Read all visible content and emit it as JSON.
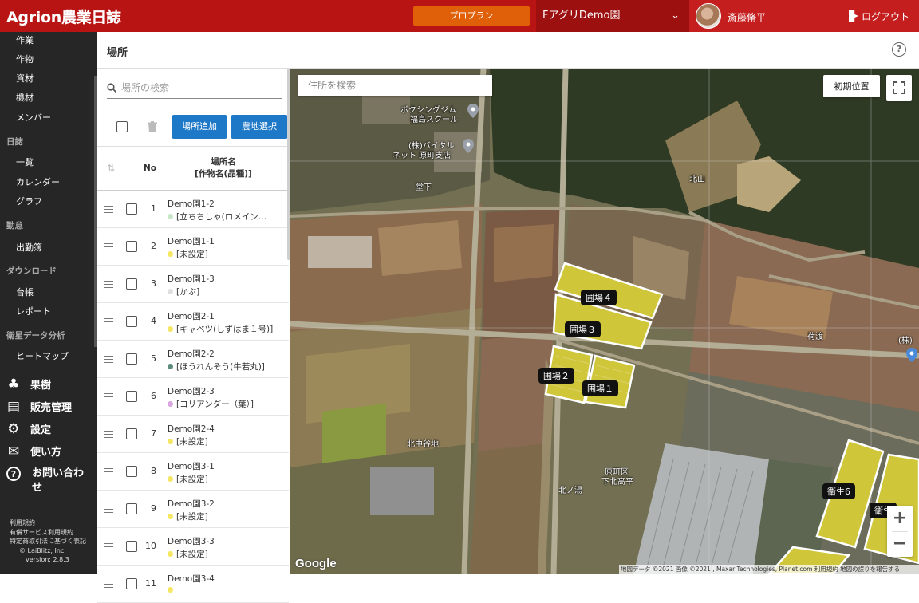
{
  "header": {
    "logo": "Agrion農業日誌",
    "plan_button": "プロプラン",
    "farm_select": "FアグリDemo園",
    "user_name": "斎藤脩平",
    "logout": "ログアウト"
  },
  "sidebar": {
    "top_items": [
      "作業",
      "作物",
      "資材",
      "機材",
      "メンバー"
    ],
    "diary_head": "日誌",
    "diary_items": [
      "一覧",
      "カレンダー",
      "グラフ"
    ],
    "attendance_head": "勤怠",
    "attendance_items": [
      "出勤簿"
    ],
    "download_head": "ダウンロード",
    "download_items": [
      "台帳",
      "レポート"
    ],
    "satellite_head": "衛星データ分析",
    "satellite_items": [
      "ヒートマップ"
    ],
    "big_items": [
      "果樹",
      "販売管理",
      "設定",
      "使い方",
      "お問い合わせ"
    ],
    "footer": [
      "利用規約",
      "有償サービス利用規約",
      "特定商取引法に基づく表記",
      "© LaiBlitz, Inc.",
      "version: 2.8.3"
    ]
  },
  "page": {
    "title": "場所"
  },
  "panel": {
    "search_placeholder": "場所の検索",
    "add_button": "場所追加",
    "select_button": "農地選択",
    "col_no": "No",
    "col_name_1": "場所名",
    "col_name_2": "[作物名(品種)]",
    "rows": [
      {
        "no": "1",
        "name": "Demo園1-2",
        "crop": "[立ちちしゃ(ロメイン…",
        "dot": "#c8e6c9"
      },
      {
        "no": "2",
        "name": "Demo園1-1",
        "crop": "[未設定]",
        "dot": "#f5e663"
      },
      {
        "no": "3",
        "name": "Demo園1-3",
        "crop": "[かぶ]",
        "dot": "#e0e0e0"
      },
      {
        "no": "4",
        "name": "Demo園2-1",
        "crop": "[キャベツ(しずはま１号)]",
        "dot": "#f5e663"
      },
      {
        "no": "5",
        "name": "Demo園2-2",
        "crop": "[ほうれんそう(牛若丸)]",
        "dot": "#5e8c7a"
      },
      {
        "no": "6",
        "name": "Demo園2-3",
        "crop": "[コリアンダー（葉）]",
        "dot": "#d9a6e0"
      },
      {
        "no": "7",
        "name": "Demo園2-4",
        "crop": "[未設定]",
        "dot": "#f5e663"
      },
      {
        "no": "8",
        "name": "Demo園3-1",
        "crop": "[未設定]",
        "dot": "#f5e663"
      },
      {
        "no": "9",
        "name": "Demo園3-2",
        "crop": "[未設定]",
        "dot": "#f5e663"
      },
      {
        "no": "10",
        "name": "Demo園3-3",
        "crop": "[未設定]",
        "dot": "#f5e663"
      },
      {
        "no": "11",
        "name": "Demo園3-4",
        "crop": "",
        "dot": "#f5e663"
      }
    ]
  },
  "map": {
    "address_placeholder": "住所を検索",
    "initial_button": "初期位置",
    "fields": [
      "圃場４",
      "圃場３",
      "圃場２",
      "圃場１",
      "衛生6",
      "衛生"
    ],
    "places": [
      "ボクシングジム",
      "福島スクール",
      "(株)バイタル",
      "ネット 原町支店",
      "北山",
      "荷渡",
      "北中谷地",
      "原町区",
      "下北高平",
      "北ノ湯",
      "(株)",
      "堂下"
    ],
    "google": "Google",
    "attribution": "地図データ ©2021 画像 ©2021 , Maxar Technologies, Planet.com   利用規約   地図の誤りを報告する"
  }
}
